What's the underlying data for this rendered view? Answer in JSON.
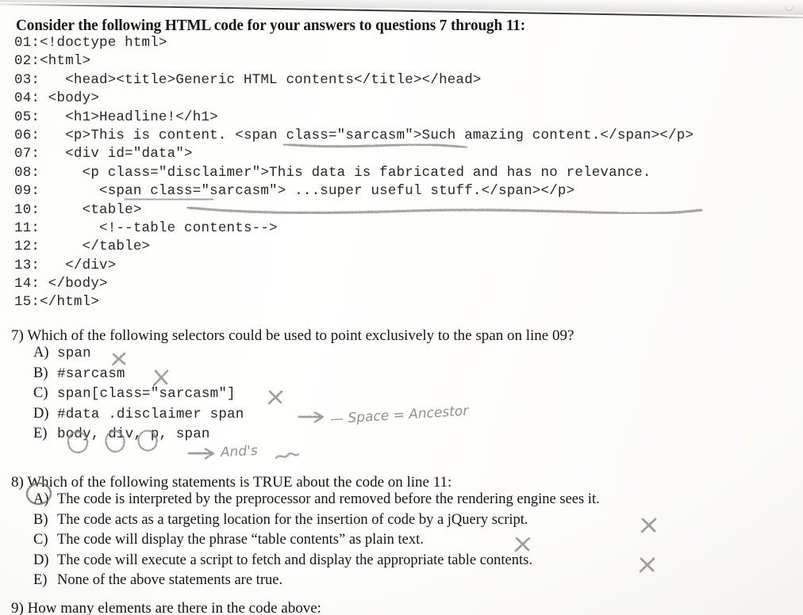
{
  "document": {
    "type": "scanned-exam-page",
    "prompt": "Consider the following HTML code for your answers to questions 7 through 11:"
  },
  "code_listing": {
    "lines": [
      {
        "number": "01:",
        "text": "<!doctype html>"
      },
      {
        "number": "02:",
        "text": "<html>"
      },
      {
        "number": "03:",
        "text": "   <head><title>Generic HTML contents</title></head>"
      },
      {
        "number": "04:",
        "text": " <body>"
      },
      {
        "number": "05:",
        "text": "   <h1>Headline!</h1>"
      },
      {
        "number": "06:",
        "text": "   <p>This is content. <span class=\"sarcasm\">Such amazing content.</span></p>"
      },
      {
        "number": "07:",
        "text": "   <div id=\"data\">"
      },
      {
        "number": "08:",
        "text": "     <p class=\"disclaimer\">This data is fabricated and has no relevance."
      },
      {
        "number": "09:",
        "text": "       <span class=\"sarcasm\"> ...super useful stuff.</span></p>"
      },
      {
        "number": "10:",
        "text": "     <table>"
      },
      {
        "number": "11:",
        "text": "       <!--table contents-->"
      },
      {
        "number": "12:",
        "text": "     </table>"
      },
      {
        "number": "13:",
        "text": "   </div>"
      },
      {
        "number": "14:",
        "text": " </body>"
      },
      {
        "number": "15:",
        "text": "</html>"
      }
    ]
  },
  "questions": [
    {
      "id": "q7",
      "number": "7)",
      "stem": "Which of the following selectors could be used to point exclusively to the span on line 09?",
      "options": [
        {
          "letter": "A)",
          "text": "span",
          "mono": true,
          "mark": "x"
        },
        {
          "letter": "B)",
          "text": "#sarcasm",
          "mono": true,
          "mark": "x"
        },
        {
          "letter": "C)",
          "text": "span[class=\"sarcasm\"]",
          "mono": true,
          "mark": "x"
        },
        {
          "letter": "D)",
          "text": "#data .disclaimer span",
          "mono": true,
          "mark": "none"
        },
        {
          "letter": "E)",
          "text": "body, div, p, span",
          "mono": true,
          "mark": "none"
        }
      ]
    },
    {
      "id": "q8",
      "number": "8)",
      "stem": "Which of the following statements is TRUE about the code on line 11:",
      "options": [
        {
          "letter": "A)",
          "text": "The code is interpreted by the preprocessor and removed before the rendering engine sees it.",
          "mono": false,
          "mark": "circled"
        },
        {
          "letter": "B)",
          "text": "The code acts as a targeting location for the insertion of code by a jQuery script.",
          "mono": false,
          "mark": "x"
        },
        {
          "letter": "C)",
          "text": "The code will display the phrase “table contents” as plain text.",
          "mono": false,
          "mark": "x"
        },
        {
          "letter": "D)",
          "text": "The code will execute a script to fetch and display the appropriate table contents.",
          "mono": false,
          "mark": "x"
        },
        {
          "letter": "E)",
          "text": "None of the above statements are true.",
          "mono": false,
          "mark": "none"
        }
      ]
    },
    {
      "id": "q9",
      "number": "9)",
      "stem": "How many elements are there in the code above:",
      "cut_off": true
    }
  ],
  "annotations": {
    "d_note": "— Space  =  Ancestor",
    "e_note": "And's",
    "e_note_tail": "~",
    "underlines": [
      {
        "label": "line-06-span-class",
        "note": "pencil underline under <span class=\"sarcasm\"> on line 06"
      },
      {
        "label": "line-09-span-class",
        "note": "pencil underline under <span class= on line 09"
      },
      {
        "label": "line-09-full",
        "note": "long wavy pencil underline beneath line 09"
      },
      {
        "label": "q8-preprocessor",
        "note": "pencil underline under the word preprocessor"
      }
    ],
    "circles": [
      {
        "label": "q7-e-comma-1"
      },
      {
        "label": "q7-e-comma-2"
      },
      {
        "label": "q7-e-comma-3"
      },
      {
        "label": "q8-option-a-letter"
      }
    ]
  },
  "colors": {
    "paper": "#fdfdfc",
    "print_ink": "#1b1a19",
    "code_ink": "#2a2927",
    "pencil": "#8d8b88",
    "scan_edge": "#2b2927"
  },
  "top_artifact": "◡"
}
